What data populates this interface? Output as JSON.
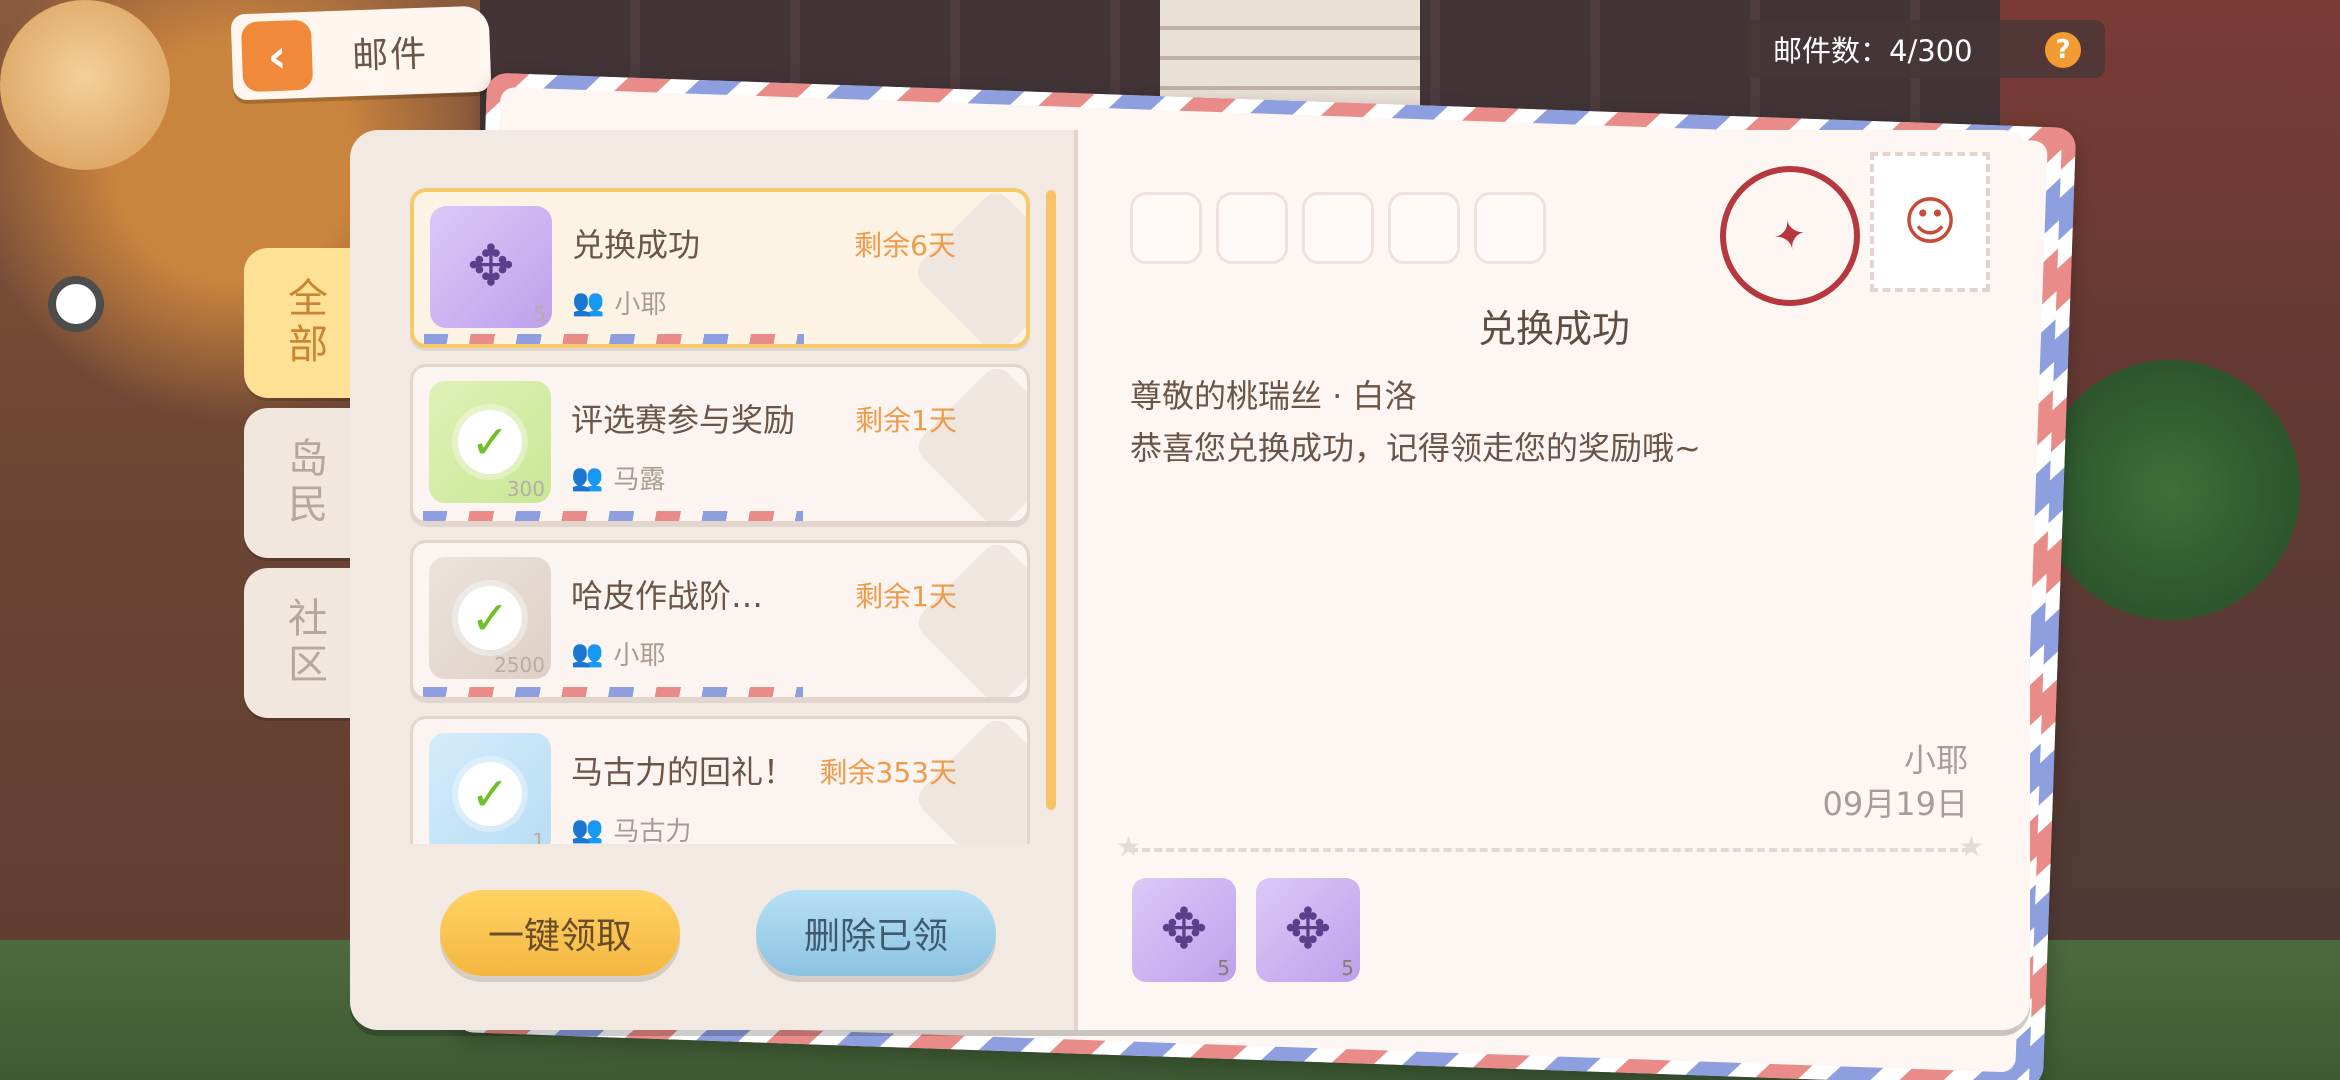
{
  "header": {
    "title": "邮件",
    "back_icon": "back-arrow-icon",
    "mail_count_label": "邮件数：4/300",
    "help_symbol": "?"
  },
  "tabs": [
    {
      "label": "全部",
      "active": true
    },
    {
      "label": "岛民",
      "active": false
    },
    {
      "label": "社区",
      "active": false
    }
  ],
  "mails": [
    {
      "title": "兑换成功",
      "days": "剩余6天",
      "sender": "小耶",
      "icon": "purple-item-icon",
      "qty": "5",
      "selected": true
    },
    {
      "title": "评选赛参与奖励",
      "days": "剩余1天",
      "sender": "马露",
      "icon": "green-trophy-check-icon",
      "qty": "300",
      "selected": false
    },
    {
      "title": "哈皮作战阶…",
      "days": "剩余1天",
      "sender": "小耶",
      "icon": "grey-coin-check-icon",
      "qty": "2500",
      "selected": false
    },
    {
      "title": "马古力的回礼！",
      "days": "剩余353天",
      "sender": "马古力",
      "icon": "blue-bear-check-icon",
      "qty": "1",
      "selected": false
    }
  ],
  "buttons": {
    "claim_all": "一键领取",
    "delete_claimed": "删除已领",
    "claim": "领取"
  },
  "detail": {
    "title": "兑换成功",
    "greeting": "尊敬的桃瑞丝 · 白洛",
    "body": "恭喜您兑换成功，记得领走您的奖励哦~",
    "sender": "小耶",
    "date": "09月19日",
    "attachments": [
      {
        "icon": "purple-item-icon",
        "qty": "5"
      },
      {
        "icon": "purple-item-icon",
        "qty": "5"
      }
    ]
  },
  "colors": {
    "accent_orange": "#f09a4b",
    "tab_active": "#ffe196",
    "claim_button": "#f7c84f",
    "delete_button": "#8cc3e2"
  }
}
